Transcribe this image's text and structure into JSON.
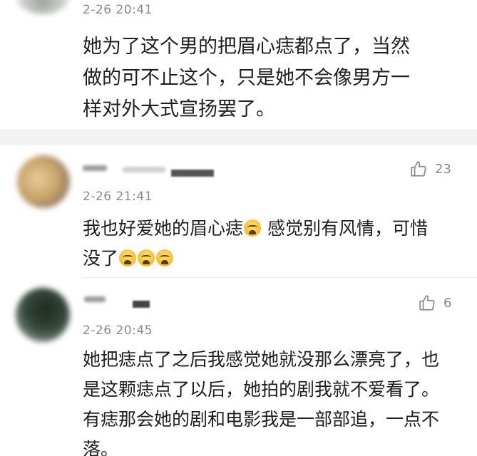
{
  "comments": [
    {
      "time": "2-26 20:41",
      "lines": [
        "她为了这个男的把眉心痣都点了，当然",
        "做的可不止这个，只是她不会像男方一",
        "样对外大式宣扬罢了。"
      ]
    },
    {
      "time": "2-26 21:41",
      "likes": "23",
      "line1_a": "我也好爱她的眉心痣",
      "line1_b": "感觉别有风情，可惜",
      "line2": "没了",
      "emoji": "crying-emoji"
    },
    {
      "time": "2-26 20:45",
      "likes": "6",
      "lines": [
        "她把痣点了之后我感觉她就没那么漂亮了，也",
        "是这颗痣点了以后，她拍的剧我就不爱看了。",
        "有痣那会她的剧和电影我是一部部追，一点不",
        "落。"
      ]
    }
  ],
  "icons": {
    "like": "thumbs-up-icon"
  },
  "colors": {
    "divider": "#f2f2f4",
    "timestamp": "#8a8a8a",
    "text": "#1f1f1f"
  }
}
